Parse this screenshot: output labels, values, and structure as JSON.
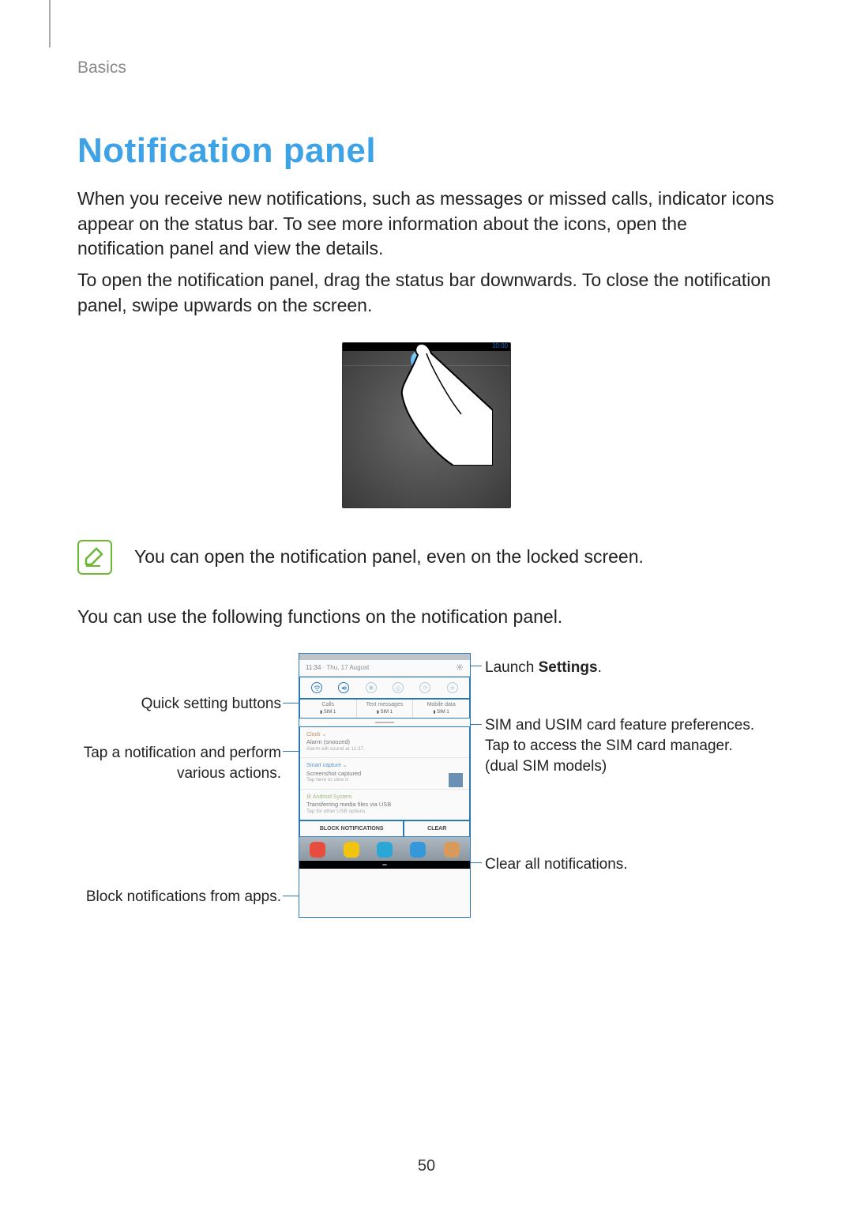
{
  "chapter": "Basics",
  "title": "Notification panel",
  "para1": "When you receive new notifications, such as messages or missed calls, indicator icons appear on the status bar. To see more information about the icons, open the notification panel and view the details.",
  "para2": "To open the notification panel, drag the status bar downwards. To close the notification panel, swipe upwards on the screen.",
  "fig1_time": "10:00",
  "note": "You can open the notification panel, even on the locked screen.",
  "para3": "You can use the following functions on the notification panel.",
  "callouts": {
    "quick_settings": "Quick setting buttons",
    "tap_notification": "Tap a notification and perform various actions.",
    "block_apps": "Block notifications from apps.",
    "launch_settings_prefix": "Launch ",
    "launch_settings_bold": "Settings",
    "launch_settings_suffix": ".",
    "sim": "SIM and USIM card feature preferences. Tap to access the SIM card manager. (dual SIM models)",
    "clear": "Clear all notifications."
  },
  "phone": {
    "header_time": "11:34",
    "header_date": "Thu, 17 August",
    "sim": {
      "col1_title": "Calls",
      "col1_sub": "SIM 1",
      "col2_title": "Text messages",
      "col2_sub": "SIM 1",
      "col3_title": "Mobile data",
      "col3_sub": "SIM 1"
    },
    "n1_top": "Clock ⌄",
    "n1_title": "Alarm (snoozed)",
    "n1_sub": "Alarm will sound at 11:37.",
    "n2_top": "Smart capture ⌄",
    "n2_title": "Screenshot captured",
    "n2_sub": "Tap here to view it.",
    "n3_top": "Android System",
    "n3_title": "Transferring media files via USB",
    "n3_sub": "Tap for other USB options.",
    "btn_block": "BLOCK NOTIFICATIONS",
    "btn_clear": "CLEAR"
  },
  "page_number": "50"
}
